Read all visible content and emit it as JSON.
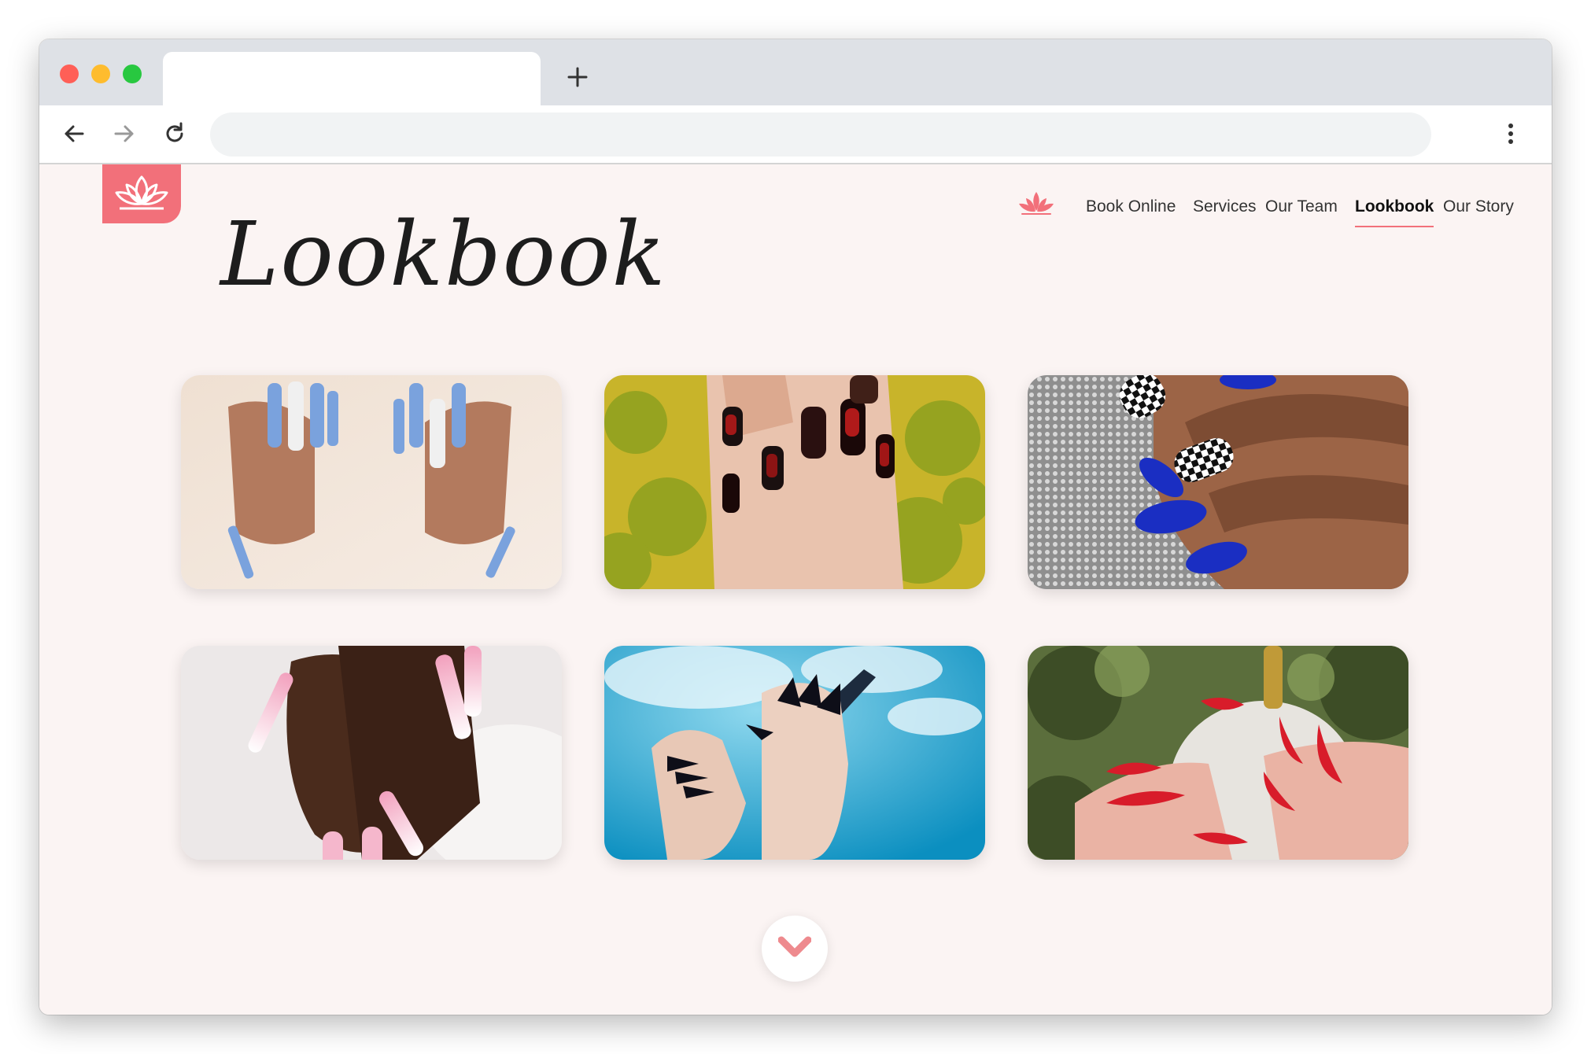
{
  "browser": {
    "tab_title": "",
    "address": ""
  },
  "site": {
    "logo_icon": "lotus-icon",
    "brand_color": "#f2707a",
    "background": "#fbf4f3"
  },
  "nav": {
    "icon": "lotus-icon",
    "items": [
      {
        "label": "Book Online",
        "active": false
      },
      {
        "label": "Services",
        "active": false
      },
      {
        "label": "Our Team",
        "active": false
      },
      {
        "label": "Lookbook",
        "active": true
      },
      {
        "label": "Our Story",
        "active": false
      }
    ]
  },
  "page": {
    "title": "Lookbook",
    "scroll_icon": "chevron-down-icon"
  },
  "gallery": [
    {
      "name": "gallery-photo-blue-coffin-nails"
    },
    {
      "name": "gallery-photo-black-red-nails"
    },
    {
      "name": "gallery-photo-checkered-blue-nails"
    },
    {
      "name": "gallery-photo-pink-ombre-nails"
    },
    {
      "name": "gallery-photo-black-stiletto-nails"
    },
    {
      "name": "gallery-photo-red-flame-nails"
    }
  ]
}
